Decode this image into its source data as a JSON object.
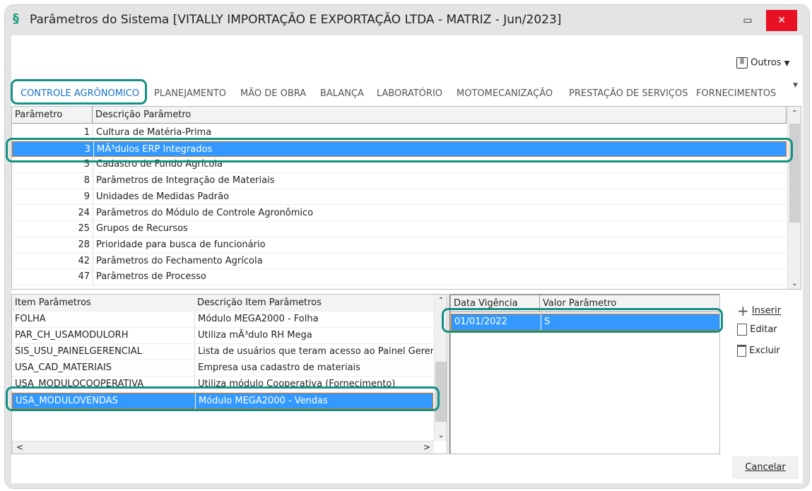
{
  "window": {
    "title": "Parâmetros do Sistema [VITALLY IMPORTAÇÃO E EXPORTAÇÃO LTDA - MATRIZ - Jun/2023]",
    "minimize": "▭",
    "close": "✕",
    "logo": "§"
  },
  "toolbar": {
    "outros": "Outros"
  },
  "tabs": [
    "CONTROLE AGRÔNOMICO",
    "PLANEJAMENTO",
    "MÃO DE OBRA",
    "BALANÇA",
    "LABORATÓRIO",
    "MOTOMECANIZAÇÃO",
    "PRESTAÇÃO DE SERVIÇOS",
    "FORNECIMENTOS"
  ],
  "params_grid": {
    "headers": [
      "Parâmetro",
      "Descrição Parâmetro"
    ],
    "rows": [
      [
        "1",
        "Cultura de Matéria-Prima"
      ],
      [
        "3",
        "MÃ³dulos ERP Integrados"
      ],
      [
        "5",
        "Cadastro de Fundo Agrícola"
      ],
      [
        "8",
        "Parâmetros de Integração de Materiais"
      ],
      [
        "9",
        "Unidades de Medidas Padrão"
      ],
      [
        "24",
        "Parâmetros do Módulo de Controle Agronômico"
      ],
      [
        "25",
        "Grupos de Recursos"
      ],
      [
        "28",
        "Prioridade para busca de funcionário"
      ],
      [
        "42",
        "Parâmetros do Fechamento Agrícola"
      ],
      [
        "47",
        "Parâmetros de Processo"
      ]
    ],
    "selected": 1
  },
  "items_grid": {
    "headers": [
      "Item Parâmetros",
      "Descrição Item Parâmetros"
    ],
    "rows": [
      [
        "FOLHA",
        "Módulo MEGA2000 - Folha"
      ],
      [
        "PAR_CH_USAMODULORH",
        "Utiliza mÃ³dulo RH Mega"
      ],
      [
        "SIS_USU_PAINELGERENCIAL",
        "Lista de usuários que teram acesso ao Painel Gerencial"
      ],
      [
        "USA_CAD_MATERIAIS",
        "Empresa usa cadastro de materiais"
      ],
      [
        "USA_MODULOCOOPERATIVA",
        "Utiliza módulo Cooperativa (Fornecimento)"
      ],
      [
        "USA_MODULOVENDAS",
        "Módulo MEGA2000 - Vendas"
      ]
    ],
    "selected": 5
  },
  "values_grid": {
    "headers": [
      "Data Vigência",
      "Valor Parâmetro"
    ],
    "rows": [
      [
        "01/01/2022",
        "S"
      ]
    ],
    "selected": 0
  },
  "actions": {
    "inserir": "Inserir",
    "editar": "Editar",
    "excluir": "Excluir",
    "cancelar": "Cancelar"
  }
}
